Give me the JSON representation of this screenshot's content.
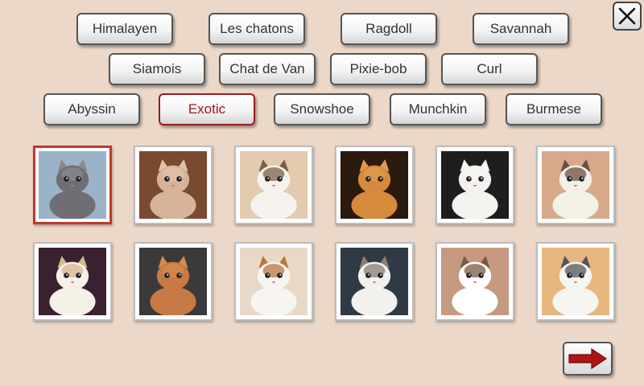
{
  "breeds": {
    "himalayen": "Himalayen",
    "les_chatons": "Les chatons",
    "ragdoll": "Ragdoll",
    "savannah": "Savannah",
    "siamois": "Siamois",
    "chat_de_van": "Chat de Van",
    "pixie_bob": "Pixie-bob",
    "curl": "Curl",
    "abyssin": "Abyssin",
    "exotic": "Exotic",
    "snowshoe": "Snowshoe",
    "munchkin": "Munchkin",
    "burmese": "Burmese"
  },
  "selected_breed": "Exotic",
  "icons": {
    "close": "close-icon",
    "next": "arrow-right-icon",
    "photo": "cat-photo"
  },
  "colors": {
    "background": "#ecd8c8",
    "selected_accent": "#a11818",
    "arrow": "#b01515"
  },
  "gallery": [
    {
      "bg": "#9ab3c8",
      "fur": "#6f6f73",
      "face": "#8a8a8e"
    },
    {
      "bg": "#7a4a30",
      "fur": "#d6b39a",
      "face": "#e1c3ad"
    },
    {
      "bg": "#e3cbb0",
      "fur": "#f6f3ef",
      "face": "#7d6049"
    },
    {
      "bg": "#2b1a0e",
      "fur": "#d58a3c",
      "face": "#e29a4c"
    },
    {
      "bg": "#1e1e1e",
      "fur": "#f4f2ee",
      "face": "#f8f6f2"
    },
    {
      "bg": "#d7a98a",
      "fur": "#f3efe9",
      "face": "#6b5040"
    },
    {
      "bg": "#3a2030",
      "fur": "#f6f1e8",
      "face": "#d9b68c"
    },
    {
      "bg": "#3a3a3a",
      "fur": "#c87a44",
      "face": "#d58b52"
    },
    {
      "bg": "#e8d9c6",
      "fur": "#f7f5f1",
      "face": "#b8773f"
    },
    {
      "bg": "#2f3a44",
      "fur": "#f3f1ed",
      "face": "#8c7d70"
    },
    {
      "bg": "#c59a80",
      "fur": "#ffffff",
      "face": "#7a5a45"
    },
    {
      "bg": "#e7b780",
      "fur": "#f7f5f0",
      "face": "#555555"
    }
  ]
}
